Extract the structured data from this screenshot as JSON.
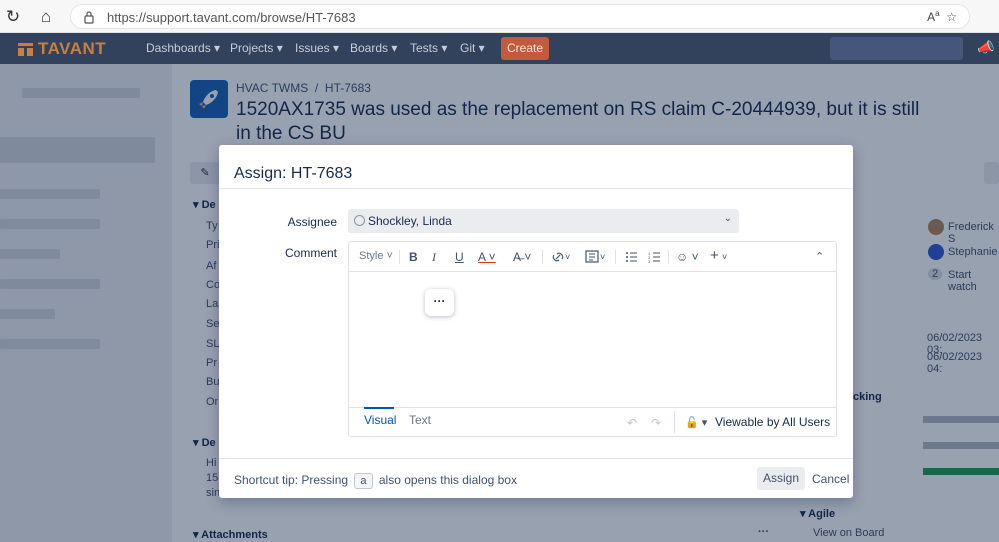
{
  "browser": {
    "url": "https://support.tavant.com/browse/HT-7683",
    "reader_icon": "Aᴬ",
    "favorites_icon": "star-icon"
  },
  "header": {
    "logo_text": "TAVANT",
    "nav": [
      "Dashboards",
      "Projects",
      "Issues",
      "Boards",
      "Tests",
      "Git"
    ],
    "create_label": "Create",
    "colors": {
      "bar": "#33425c",
      "create": "#c45a3c",
      "logo": "#c9803f"
    }
  },
  "issue": {
    "project": "HVAC TWMS",
    "key": "HT-7683",
    "title": "1520AX1735 was used as the replacement on RS claim C-20444939, but it is still in the CS BU"
  },
  "background": {
    "left_labels": [
      "Ty",
      "Pri",
      "Af",
      "Co",
      "La",
      "Se",
      "SL",
      "Pr",
      "Bu",
      "Or"
    ],
    "section_details": "De",
    "section_description": "De",
    "desc_lines": [
      "Hi",
      "15",
      "sin"
    ],
    "attachments": "Attachments",
    "right_people": [
      "Frederick S",
      "Stephanie"
    ],
    "watch_count": "2",
    "watch_label": "Start watch",
    "dates": [
      "06/02/2023 03:",
      "06/02/2023 04:"
    ],
    "tracking": "cking",
    "agile": "Agile",
    "view_board": "View on Board"
  },
  "dialog": {
    "title": "Assign: HT-7683",
    "assignee_label": "Assignee",
    "assignee_value": "Shockley, Linda",
    "comment_label": "Comment",
    "toolbar": {
      "style": "Style",
      "bold": "B",
      "italic": "I",
      "underline": "U",
      "color": "A",
      "more_formatting": "A̶",
      "link": "↗",
      "more": "…"
    },
    "tab_visual": "Visual",
    "tab_text": "Text",
    "visibility": "Viewable by All Users",
    "tip_prefix": "Shortcut tip: Pressing",
    "tip_key": "a",
    "tip_suffix": "also opens this dialog box",
    "assign_label": "Assign",
    "cancel_label": "Cancel",
    "more_button": "···"
  }
}
